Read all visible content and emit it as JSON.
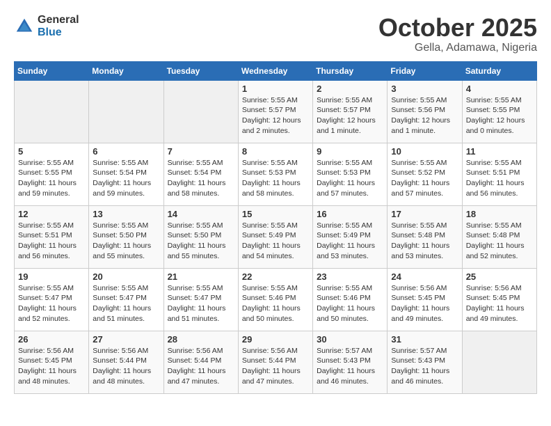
{
  "logo": {
    "general": "General",
    "blue": "Blue"
  },
  "title": "October 2025",
  "subtitle": "Gella, Adamawa, Nigeria",
  "weekdays": [
    "Sunday",
    "Monday",
    "Tuesday",
    "Wednesday",
    "Thursday",
    "Friday",
    "Saturday"
  ],
  "weeks": [
    [
      {
        "day": "",
        "sunrise": "",
        "sunset": "",
        "daylight": ""
      },
      {
        "day": "",
        "sunrise": "",
        "sunset": "",
        "daylight": ""
      },
      {
        "day": "",
        "sunrise": "",
        "sunset": "",
        "daylight": ""
      },
      {
        "day": "1",
        "sunrise": "Sunrise: 5:55 AM",
        "sunset": "Sunset: 5:57 PM",
        "daylight": "Daylight: 12 hours and 2 minutes."
      },
      {
        "day": "2",
        "sunrise": "Sunrise: 5:55 AM",
        "sunset": "Sunset: 5:57 PM",
        "daylight": "Daylight: 12 hours and 1 minute."
      },
      {
        "day": "3",
        "sunrise": "Sunrise: 5:55 AM",
        "sunset": "Sunset: 5:56 PM",
        "daylight": "Daylight: 12 hours and 1 minute."
      },
      {
        "day": "4",
        "sunrise": "Sunrise: 5:55 AM",
        "sunset": "Sunset: 5:55 PM",
        "daylight": "Daylight: 12 hours and 0 minutes."
      }
    ],
    [
      {
        "day": "5",
        "sunrise": "Sunrise: 5:55 AM",
        "sunset": "Sunset: 5:55 PM",
        "daylight": "Daylight: 11 hours and 59 minutes."
      },
      {
        "day": "6",
        "sunrise": "Sunrise: 5:55 AM",
        "sunset": "Sunset: 5:54 PM",
        "daylight": "Daylight: 11 hours and 59 minutes."
      },
      {
        "day": "7",
        "sunrise": "Sunrise: 5:55 AM",
        "sunset": "Sunset: 5:54 PM",
        "daylight": "Daylight: 11 hours and 58 minutes."
      },
      {
        "day": "8",
        "sunrise": "Sunrise: 5:55 AM",
        "sunset": "Sunset: 5:53 PM",
        "daylight": "Daylight: 11 hours and 58 minutes."
      },
      {
        "day": "9",
        "sunrise": "Sunrise: 5:55 AM",
        "sunset": "Sunset: 5:53 PM",
        "daylight": "Daylight: 11 hours and 57 minutes."
      },
      {
        "day": "10",
        "sunrise": "Sunrise: 5:55 AM",
        "sunset": "Sunset: 5:52 PM",
        "daylight": "Daylight: 11 hours and 57 minutes."
      },
      {
        "day": "11",
        "sunrise": "Sunrise: 5:55 AM",
        "sunset": "Sunset: 5:51 PM",
        "daylight": "Daylight: 11 hours and 56 minutes."
      }
    ],
    [
      {
        "day": "12",
        "sunrise": "Sunrise: 5:55 AM",
        "sunset": "Sunset: 5:51 PM",
        "daylight": "Daylight: 11 hours and 56 minutes."
      },
      {
        "day": "13",
        "sunrise": "Sunrise: 5:55 AM",
        "sunset": "Sunset: 5:50 PM",
        "daylight": "Daylight: 11 hours and 55 minutes."
      },
      {
        "day": "14",
        "sunrise": "Sunrise: 5:55 AM",
        "sunset": "Sunset: 5:50 PM",
        "daylight": "Daylight: 11 hours and 55 minutes."
      },
      {
        "day": "15",
        "sunrise": "Sunrise: 5:55 AM",
        "sunset": "Sunset: 5:49 PM",
        "daylight": "Daylight: 11 hours and 54 minutes."
      },
      {
        "day": "16",
        "sunrise": "Sunrise: 5:55 AM",
        "sunset": "Sunset: 5:49 PM",
        "daylight": "Daylight: 11 hours and 53 minutes."
      },
      {
        "day": "17",
        "sunrise": "Sunrise: 5:55 AM",
        "sunset": "Sunset: 5:48 PM",
        "daylight": "Daylight: 11 hours and 53 minutes."
      },
      {
        "day": "18",
        "sunrise": "Sunrise: 5:55 AM",
        "sunset": "Sunset: 5:48 PM",
        "daylight": "Daylight: 11 hours and 52 minutes."
      }
    ],
    [
      {
        "day": "19",
        "sunrise": "Sunrise: 5:55 AM",
        "sunset": "Sunset: 5:47 PM",
        "daylight": "Daylight: 11 hours and 52 minutes."
      },
      {
        "day": "20",
        "sunrise": "Sunrise: 5:55 AM",
        "sunset": "Sunset: 5:47 PM",
        "daylight": "Daylight: 11 hours and 51 minutes."
      },
      {
        "day": "21",
        "sunrise": "Sunrise: 5:55 AM",
        "sunset": "Sunset: 5:47 PM",
        "daylight": "Daylight: 11 hours and 51 minutes."
      },
      {
        "day": "22",
        "sunrise": "Sunrise: 5:55 AM",
        "sunset": "Sunset: 5:46 PM",
        "daylight": "Daylight: 11 hours and 50 minutes."
      },
      {
        "day": "23",
        "sunrise": "Sunrise: 5:55 AM",
        "sunset": "Sunset: 5:46 PM",
        "daylight": "Daylight: 11 hours and 50 minutes."
      },
      {
        "day": "24",
        "sunrise": "Sunrise: 5:56 AM",
        "sunset": "Sunset: 5:45 PM",
        "daylight": "Daylight: 11 hours and 49 minutes."
      },
      {
        "day": "25",
        "sunrise": "Sunrise: 5:56 AM",
        "sunset": "Sunset: 5:45 PM",
        "daylight": "Daylight: 11 hours and 49 minutes."
      }
    ],
    [
      {
        "day": "26",
        "sunrise": "Sunrise: 5:56 AM",
        "sunset": "Sunset: 5:45 PM",
        "daylight": "Daylight: 11 hours and 48 minutes."
      },
      {
        "day": "27",
        "sunrise": "Sunrise: 5:56 AM",
        "sunset": "Sunset: 5:44 PM",
        "daylight": "Daylight: 11 hours and 48 minutes."
      },
      {
        "day": "28",
        "sunrise": "Sunrise: 5:56 AM",
        "sunset": "Sunset: 5:44 PM",
        "daylight": "Daylight: 11 hours and 47 minutes."
      },
      {
        "day": "29",
        "sunrise": "Sunrise: 5:56 AM",
        "sunset": "Sunset: 5:44 PM",
        "daylight": "Daylight: 11 hours and 47 minutes."
      },
      {
        "day": "30",
        "sunrise": "Sunrise: 5:57 AM",
        "sunset": "Sunset: 5:43 PM",
        "daylight": "Daylight: 11 hours and 46 minutes."
      },
      {
        "day": "31",
        "sunrise": "Sunrise: 5:57 AM",
        "sunset": "Sunset: 5:43 PM",
        "daylight": "Daylight: 11 hours and 46 minutes."
      },
      {
        "day": "",
        "sunrise": "",
        "sunset": "",
        "daylight": ""
      }
    ]
  ]
}
